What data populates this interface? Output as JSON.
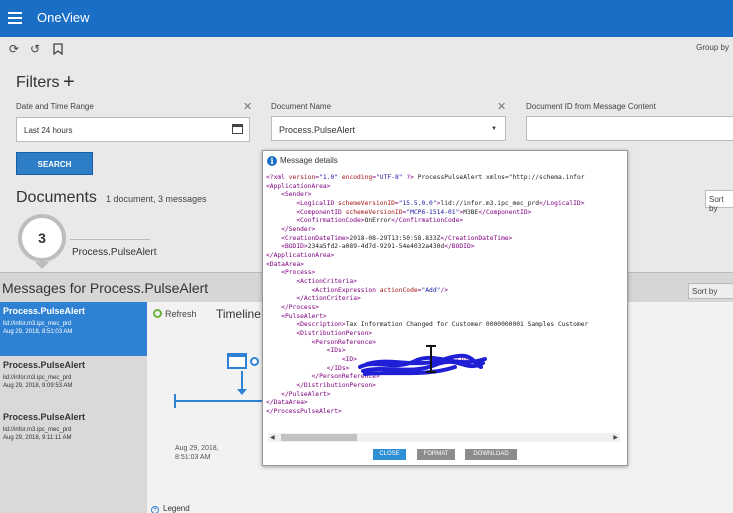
{
  "app": {
    "title": "OneView"
  },
  "toolbar": {
    "group_by": "Group by"
  },
  "filters": {
    "title": "Filters",
    "date_range": {
      "label": "Date and Time Range",
      "value": "Last 24 hours"
    },
    "document_name": {
      "label": "Document Name",
      "value": "Process.PulseAlert"
    },
    "document_id": {
      "label": "Document ID from Message Content",
      "value": ""
    },
    "search_label": "SEARCH"
  },
  "documents": {
    "title": "Documents",
    "subtitle": "1 document, 3 messages",
    "sort_by": "Sort by",
    "count": "3",
    "name": "Process.PulseAlert"
  },
  "messages": {
    "title": "Messages for Process.PulseAlert",
    "sort_by": "Sort by",
    "items": [
      {
        "title": "Process.PulseAlert",
        "line": "lid://infor.m3.ipc_mec_prd",
        "date": "Aug 29, 2018, 8:51:03 AM"
      },
      {
        "title": "Process.PulseAlert",
        "line": "lid://infor.m3.ipc_mec_prd",
        "date": "Aug 29, 2018, 9:09:53 AM"
      },
      {
        "title": "Process.PulseAlert",
        "line": "lid://infor.m3.ipc_mec_prd",
        "date": "Aug 29, 2018, 9:11:11 AM"
      }
    ]
  },
  "timeline": {
    "refresh_label": "Refresh",
    "title": "Timeline",
    "date_line1": "Aug 29, 2018,",
    "date_line2": "8:51:03 AM",
    "legend_label": "Legend"
  },
  "modal": {
    "title": "Message details",
    "lines": [
      "<?xml version=\"1.0\" encoding=\"UTF-8\" ?> <ProcessPulseAlert xmlns=\"http://schema.infor",
      "<ApplicationArea>",
      "    <Sender>",
      "        <LogicalID schemeVersionID=\"15.5.0.0\">lid://infor.m3.ipc_mec_prd</LogicalID>",
      "        <ComponentID schemeVersionID=\"MCP6-1514-01\">M3BE</ComponentID>",
      "        <ConfirmationCode>OnError</ConfirmationCode>",
      "    </Sender>",
      "    <CreationDateTime>2018-08-29T13:50:58.833Z</CreationDateTime>",
      "    <BODID>234a5fd2-a089-4d7d-9291-54e4032a430d</BODID>",
      "</ApplicationArea>",
      "<DataArea>",
      "    <Process>",
      "        <ActionCriteria>",
      "            <ActionExpression actionCode=\"Add\"/>",
      "        </ActionCriteria>",
      "    </Process>",
      "    <PulseAlert>",
      "        <Description>Tax Information Changed for Customer 0000000001 Samples Customer",
      "        <DistributionPerson>",
      "            <PersonReference>",
      "                <IDs>",
      "                    <ID>                         </ID>",
      "                </IDs>",
      "            </PersonReference>",
      "        </DistributionPerson>",
      "    </PulseAlert>",
      "</DataArea>",
      "</ProcessPulseAlert>"
    ],
    "close_label": "CLOSE",
    "format_label": "FORMAT",
    "download_label": "DOWNLOAD"
  },
  "colors": {
    "brand": "#1a6ec6",
    "accent": "#2f82d3",
    "refresh": "#6cb33e",
    "redaction": "#1f1fd6"
  }
}
